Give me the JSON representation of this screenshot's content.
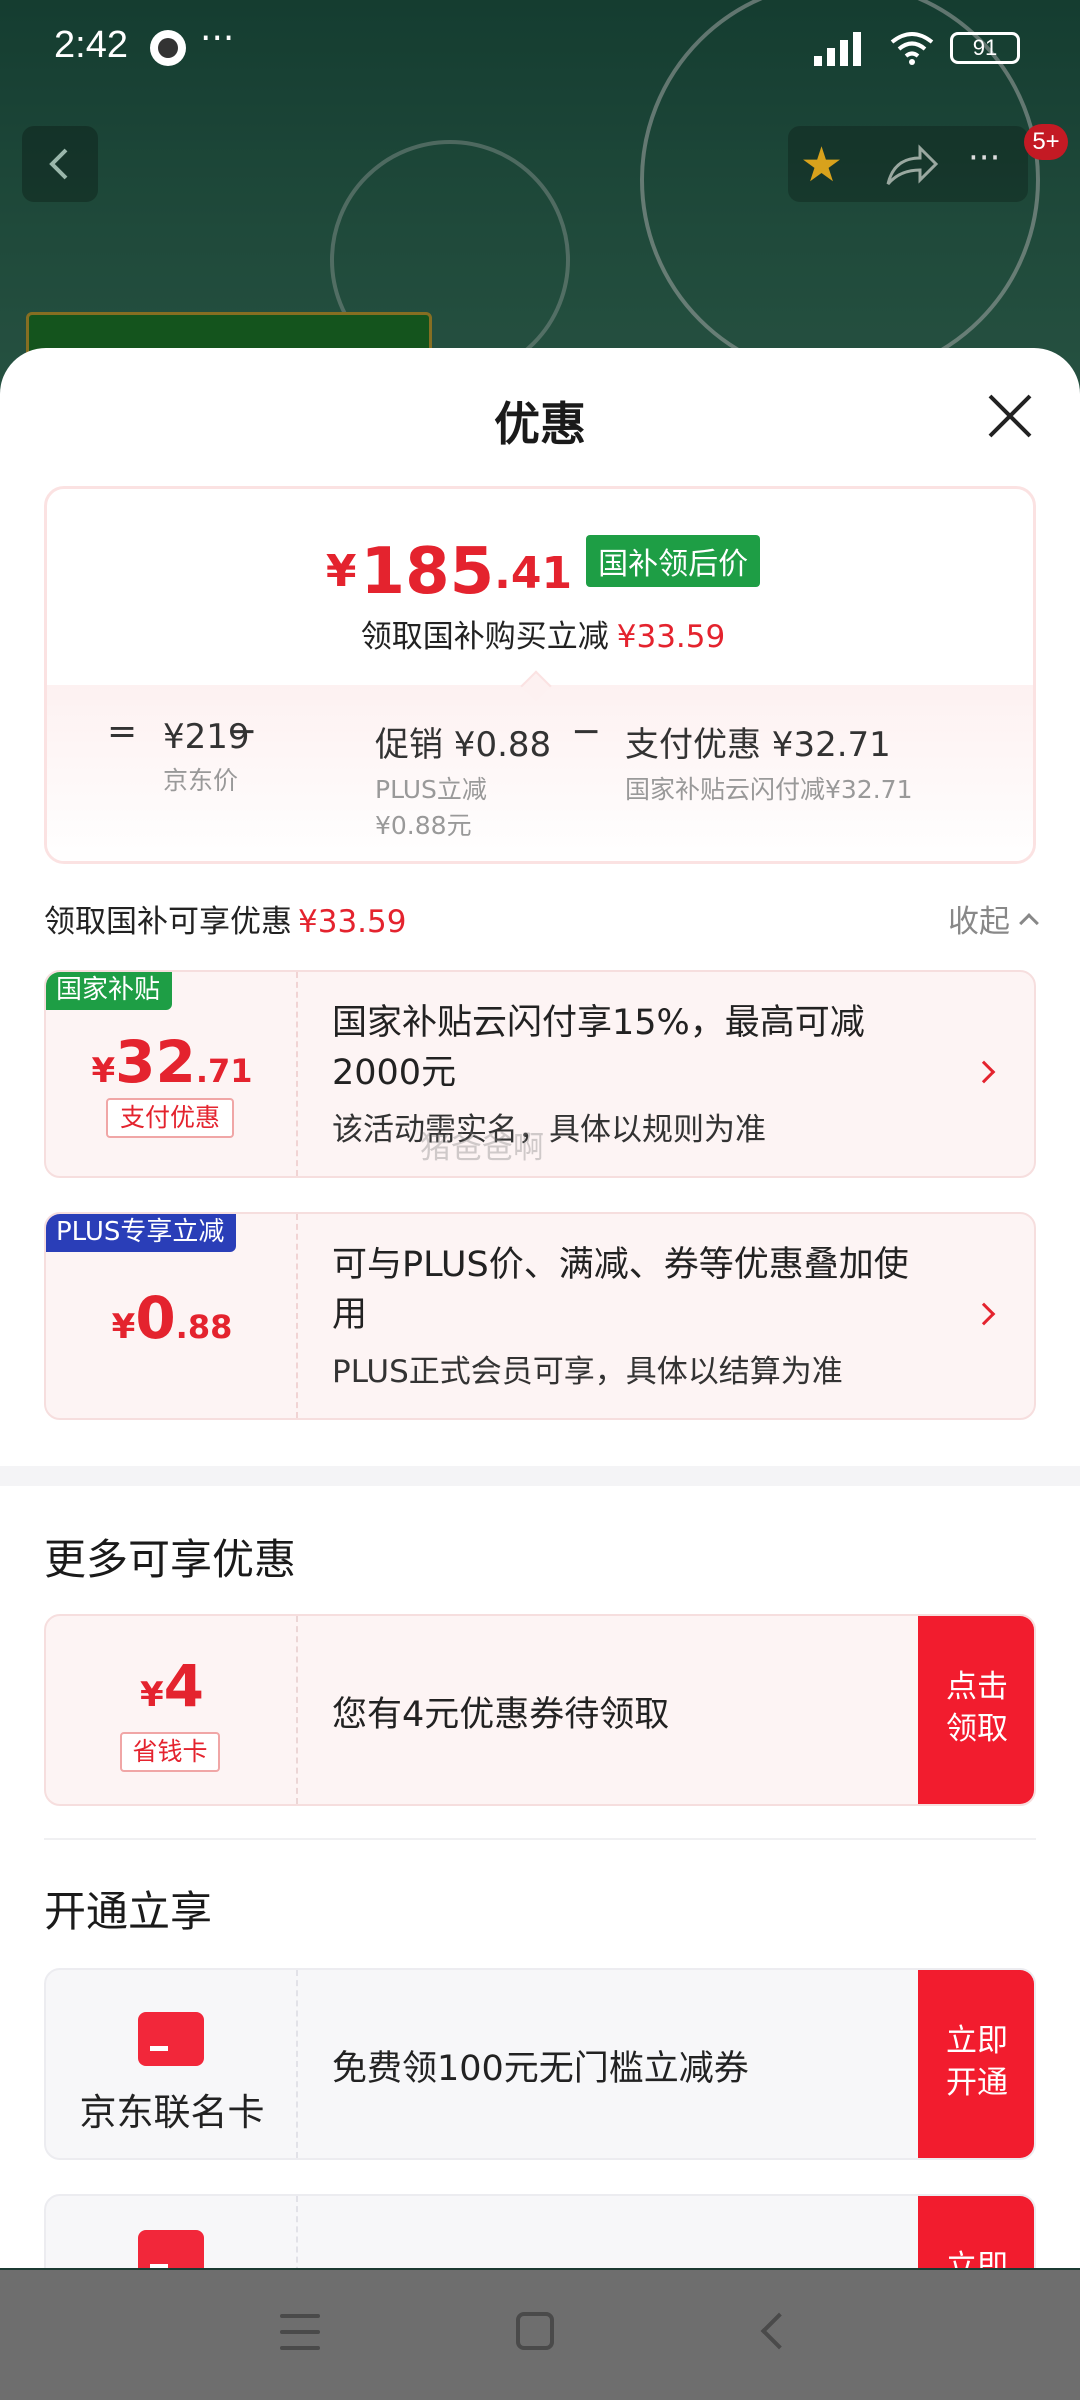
{
  "status_bar": {
    "time": "2:42",
    "dots": "···",
    "battery": "91"
  },
  "background": {
    "badge": "5+"
  },
  "sheet": {
    "title": "优惠",
    "price": {
      "currency": "¥",
      "integer": "185",
      "decimal": ".41",
      "tag": "国补领后价",
      "sub_label": "领取国补购买立减",
      "sub_amount": "¥33.59"
    },
    "breakdown": {
      "eq": "=",
      "base_price": "¥219",
      "base_label": "京东价",
      "minus1": "−",
      "promo": "促销 ¥0.88",
      "promo_detail_1": "PLUS立减",
      "promo_detail_2": "¥0.88元",
      "minus2": "−",
      "payment": "支付优惠 ¥32.71",
      "payment_detail": "国家补贴云闪付减¥32.71"
    },
    "summary": {
      "label": "领取国补可享优惠",
      "amount": "¥33.59",
      "collapse": "收起"
    },
    "offers": [
      {
        "tag": "国家补贴",
        "currency": "¥",
        "integer": "32",
        "decimal": ".71",
        "sub_tag": "支付优惠",
        "title": "国家补贴云闪付享15%，最高可减2000元",
        "desc": "该活动需实名，具体以规则为准"
      },
      {
        "tag": "PLUS专享立减",
        "currency": "¥",
        "integer": "0",
        "decimal": ".88",
        "title": "可与PLUS价、满减、券等优惠叠加使用",
        "desc": "PLUS正式会员可享，具体以结算为准"
      }
    ],
    "watermark": "猪爸爸啊",
    "more_section": {
      "title": "更多可享优惠",
      "coupon": {
        "currency": "¥",
        "integer": "4",
        "sub_tag": "省钱卡",
        "text": "您有4元优惠券待领取",
        "button_line1": "点击",
        "button_line2": "领取"
      }
    },
    "open_section": {
      "title": "开通立享",
      "card": {
        "name": "京东联名卡",
        "text": "免费领100元无门槛立减券",
        "button_line1": "立即",
        "button_line2": "开通"
      },
      "partial_button": "立即"
    }
  },
  "colors": {
    "accent_red": "#e4232e",
    "button_red": "#f21c2e",
    "tag_green": "#1e9e45",
    "plus_blue": "#2a3eb8"
  },
  "icons": [
    "back-icon",
    "star-icon",
    "share-icon",
    "more-icon",
    "close-icon",
    "chevron-up-icon",
    "chevron-right-icon",
    "card-icon",
    "menu-icon",
    "home-icon",
    "back-nav-icon"
  ]
}
